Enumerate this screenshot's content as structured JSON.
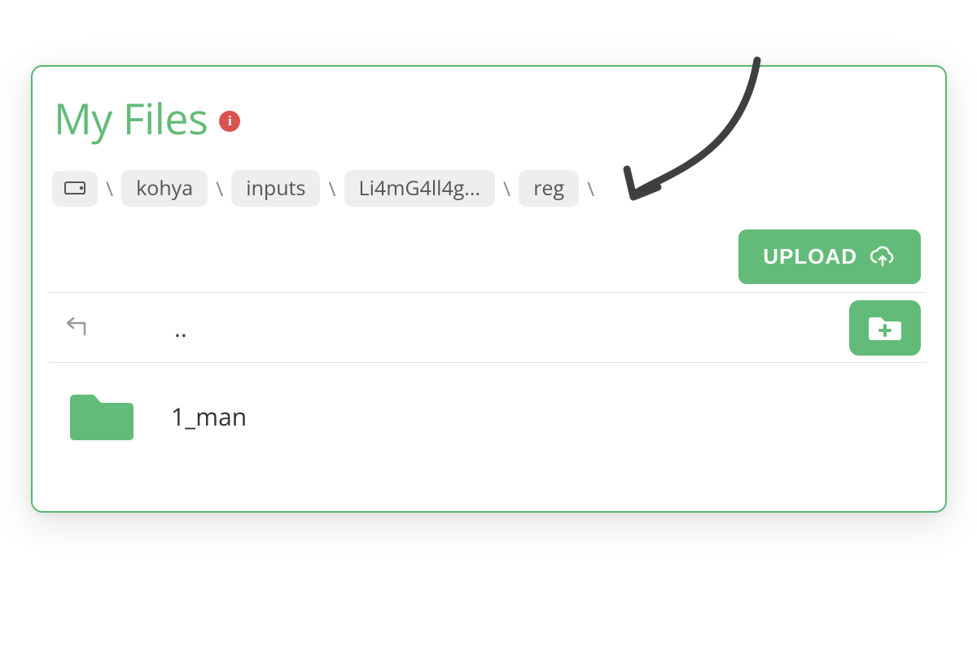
{
  "header": {
    "title": "My Files",
    "info_glyph": "i"
  },
  "breadcrumb": {
    "separator": "\\",
    "items": [
      "kohya",
      "inputs",
      "Li4mG4ll4g...",
      "reg"
    ]
  },
  "actions": {
    "upload_label": "UPLOAD"
  },
  "listing": {
    "parent_label": "..",
    "folders": [
      {
        "name": "1_man"
      }
    ]
  },
  "colors": {
    "accent": "#62bb78",
    "accent_border": "#5bb872",
    "danger": "#d9534f",
    "muted_bg": "#eeeeee",
    "text": "#333333",
    "sep": "#888888"
  }
}
